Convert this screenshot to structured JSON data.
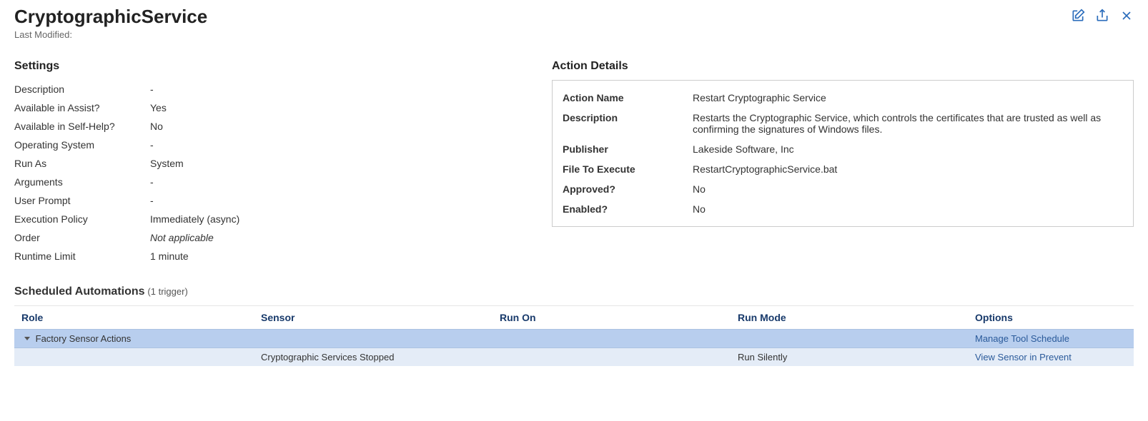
{
  "header": {
    "title": "CryptographicService",
    "last_modified_label": "Last Modified:",
    "last_modified_value": ""
  },
  "settings": {
    "heading": "Settings",
    "rows": {
      "description_label": "Description",
      "description_value": "-",
      "available_assist_label": "Available in Assist?",
      "available_assist_value": "Yes",
      "available_selfhelp_label": "Available in Self-Help?",
      "available_selfhelp_value": "No",
      "os_label": "Operating System",
      "os_value": "-",
      "runas_label": "Run As",
      "runas_value": "System",
      "arguments_label": "Arguments",
      "arguments_value": "-",
      "userprompt_label": "User Prompt",
      "userprompt_value": "-",
      "execpolicy_label": "Execution Policy",
      "execpolicy_value": "Immediately (async)",
      "order_label": "Order",
      "order_value": "Not applicable",
      "runtimelimit_label": "Runtime Limit",
      "runtimelimit_value": "1 minute"
    }
  },
  "action_details": {
    "heading": "Action Details",
    "rows": {
      "actionname_label": "Action Name",
      "actionname_value": "Restart Cryptographic Service",
      "description_label": "Description",
      "description_value": "Restarts the Cryptographic Service, which controls the certificates that are trusted as well as confirming the signatures of Windows files.",
      "publisher_label": "Publisher",
      "publisher_value": "Lakeside Software, Inc",
      "file_label": "File To Execute",
      "file_value": "RestartCryptographicService.bat",
      "approved_label": "Approved?",
      "approved_value": "No",
      "enabled_label": "Enabled?",
      "enabled_value": "No"
    }
  },
  "scheduled": {
    "heading": "Scheduled Automations",
    "trigger_count": "(1 trigger)",
    "columns": {
      "role": "Role",
      "sensor": "Sensor",
      "runon": "Run On",
      "runmode": "Run Mode",
      "options": "Options"
    },
    "group": {
      "role": "Factory Sensor Actions",
      "options_link": "Manage Tool Schedule"
    },
    "row": {
      "sensor": "Cryptographic Services Stopped",
      "runon": "",
      "runmode": "Run Silently",
      "options_link": "View Sensor in Prevent"
    }
  }
}
